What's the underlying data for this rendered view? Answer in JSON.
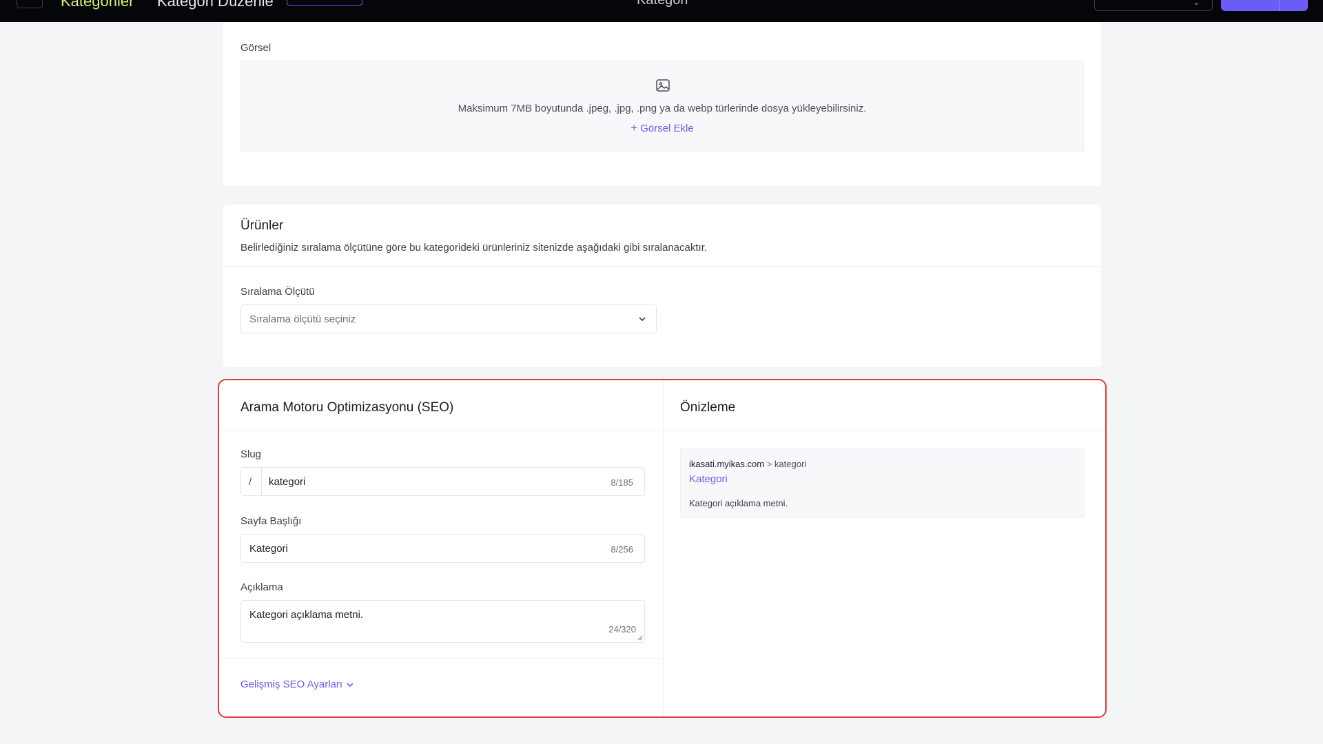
{
  "topbar": {
    "breadcrumb_root": "Kategoriler",
    "breadcrumb_current": "Kategori Düzenle",
    "center_title": "Kategori"
  },
  "gorsel": {
    "label": "Görsel",
    "upload_hint": "Maksimum 7MB boyutunda .jpeg, .jpg, .png ya da webp türlerinde dosya yükleyebilirsiniz.",
    "add_button": "Görsel Ekle",
    "icons": {
      "image": "image-icon",
      "plus": "plus-icon"
    }
  },
  "urunler": {
    "title": "Ürünler",
    "description": "Belirlediğiniz sıralama ölçütüne göre bu kategorideki ürünleriniz sitenizde aşağıdaki gibi sıralanacaktır.",
    "sort_label": "Sıralama Ölçütü",
    "sort_placeholder": "Sıralama ölçütü seçiniz"
  },
  "seo": {
    "title": "Arama Motoru Optimizasyonu (SEO)",
    "slug": {
      "label": "Slug",
      "prefix": "/",
      "value": "kategori",
      "counter": "8/185"
    },
    "page_title": {
      "label": "Sayfa Başlığı",
      "value": "Kategori",
      "counter": "8/256"
    },
    "description": {
      "label": "Açıklama",
      "value": "Kategori açıklama metni.",
      "counter": "24/320"
    },
    "advanced_toggle": "Gelişmiş SEO Ayarları"
  },
  "preview": {
    "title": "Önizleme",
    "domain": "ikasati.myikas.com",
    "separator": ">",
    "path": "kategori",
    "page_title": "Kategori",
    "description": "Kategori açıklama metni."
  },
  "colors": {
    "accent": "#6c5cf6",
    "highlight_border": "#e53935",
    "topbar_bg": "#05060a",
    "topbar_breadcrumb": "#d4f36b"
  }
}
